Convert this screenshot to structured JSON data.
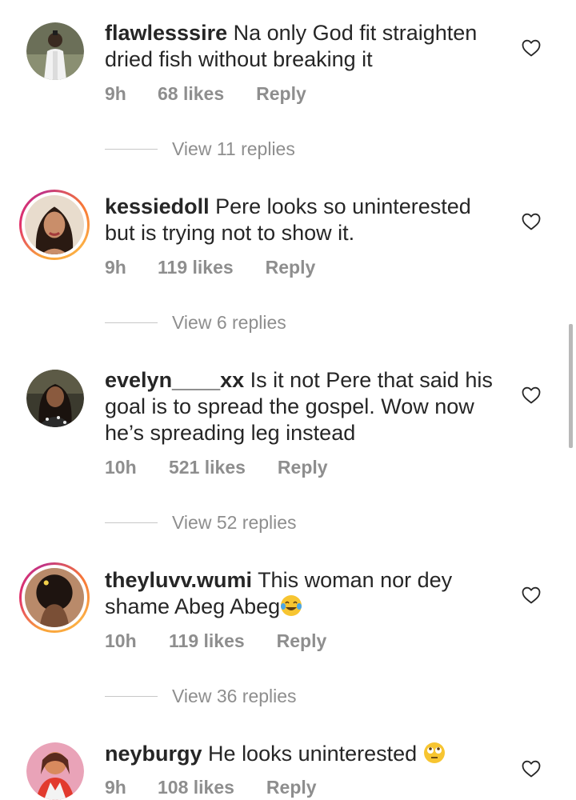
{
  "comments": [
    {
      "username": "flawlesssire",
      "text": "Na only God fit straighten dried fish without breaking it",
      "time": "9h",
      "likes": "68 likes",
      "reply": "Reply",
      "view_replies": "View 11 replies",
      "emoji": ""
    },
    {
      "username": "kessiedoll",
      "text": "Pere looks so uninterested but is trying not to show it.",
      "time": "9h",
      "likes": "119 likes",
      "reply": "Reply",
      "view_replies": "View 6 replies",
      "emoji": ""
    },
    {
      "username": "evelyn____xx",
      "text": "Is it not Pere that said his goal is to spread the gospel. Wow now he’s spreading leg instead",
      "time": "10h",
      "likes": "521 likes",
      "reply": "Reply",
      "view_replies": "View 52 replies",
      "emoji": ""
    },
    {
      "username": "theyluvv.wumi",
      "text": "This woman nor dey shame Abeg Abeg",
      "time": "10h",
      "likes": "119 likes",
      "reply": "Reply",
      "view_replies": "View 36 replies",
      "emoji": "face-with-tears-of-joy"
    },
    {
      "username": "neyburgy",
      "text": "He looks uninterested",
      "time": "9h",
      "likes": "108 likes",
      "reply": "Reply",
      "view_replies": "",
      "emoji": "face-with-rolling-eyes"
    }
  ],
  "colors": {
    "text": "#262626",
    "secondary": "#8e8e8e",
    "story_ring_start": "#f9a43a",
    "story_ring_end": "#c13584"
  }
}
